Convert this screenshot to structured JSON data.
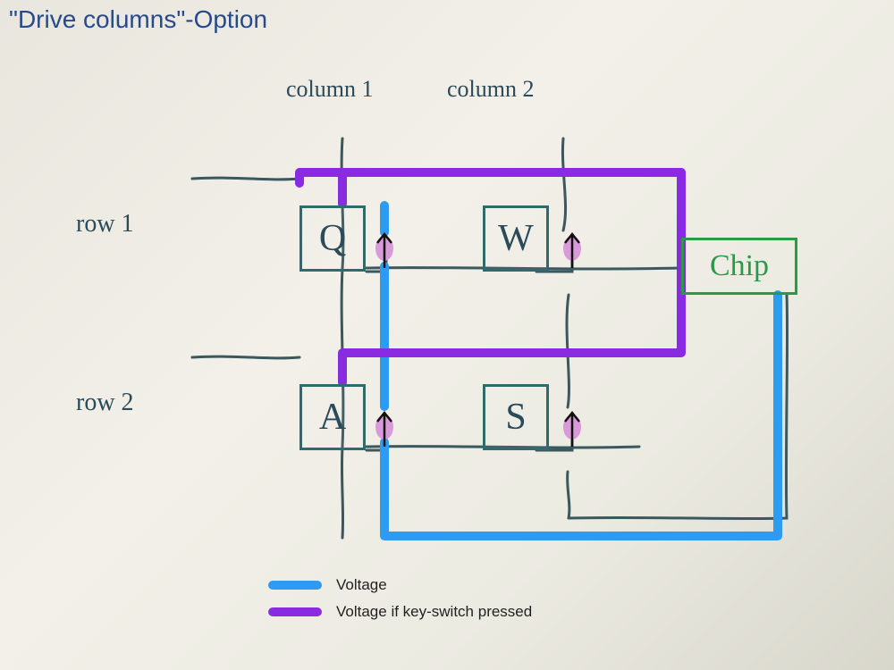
{
  "title": "\"Drive columns\"-Option",
  "columns": {
    "c1": "column 1",
    "c2": "column 2"
  },
  "rows": {
    "r1": "row 1",
    "r2": "row 2"
  },
  "keys": {
    "k11": "Q",
    "k12": "W",
    "k21": "A",
    "k22": "S"
  },
  "chip": "Chip",
  "legend": {
    "voltage": "Voltage",
    "voltage_pressed": "Voltage if key-switch pressed"
  },
  "colors": {
    "voltage": "#2e9af2",
    "voltage_pressed": "#8a2be2",
    "pen": "#3a585e",
    "chip": "#2a9a4a"
  }
}
